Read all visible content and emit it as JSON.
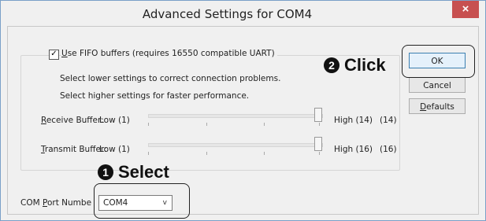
{
  "window": {
    "title": "Advanced Settings for COM4",
    "close_glyph": "×"
  },
  "fifo": {
    "checkbox_checked": true,
    "check_glyph": "✓",
    "label_accel": "U",
    "label_rest": "se FIFO buffers (requires 16550 compatible UART)",
    "hint_lower": "Select lower settings to correct connection problems.",
    "hint_higher": "Select higher settings for faster performance."
  },
  "receive": {
    "label_accel": "R",
    "label_rest": "eceive Buffer:",
    "low": "Low (1)",
    "high": "High (14)",
    "value": "(14)",
    "level": 1.0
  },
  "transmit": {
    "label_accel": "T",
    "label_rest": "ransmit Buffer:",
    "low": "Low (1)",
    "high": "High (16)",
    "value": "(16)",
    "level": 1.0
  },
  "port": {
    "label_pre": "COM ",
    "label_accel": "P",
    "label_post": "ort Numbe",
    "selected": "COM4",
    "arrow_icon": "chevron-down-icon",
    "arrow_glyph": "v"
  },
  "buttons": {
    "ok": "OK",
    "cancel": "Cancel",
    "defaults_accel": "D",
    "defaults_rest": "efaults"
  },
  "annotations": {
    "select_number": "1",
    "select_text": "Select",
    "click_number": "2",
    "click_text": "Click"
  }
}
